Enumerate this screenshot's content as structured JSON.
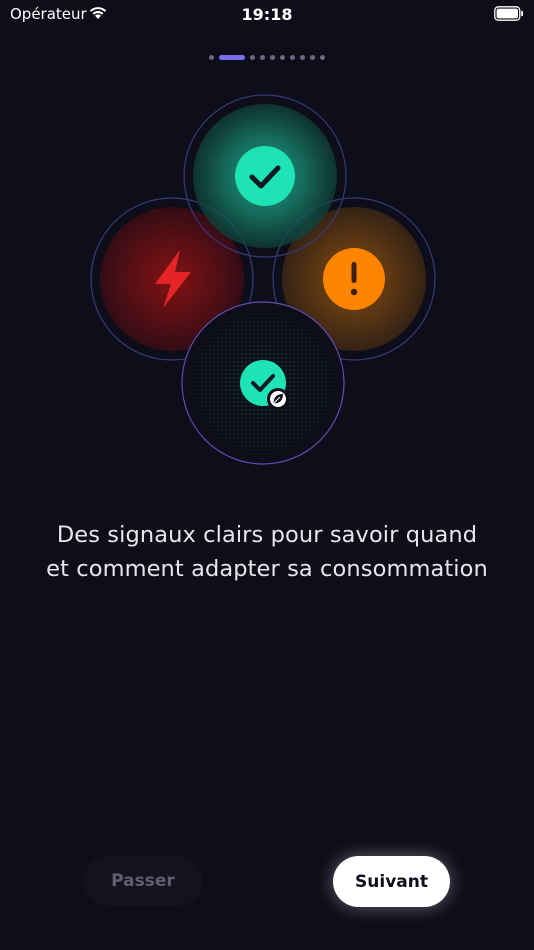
{
  "status_bar": {
    "carrier": "Opérateur",
    "time": "19:18"
  },
  "pager": {
    "total": 10,
    "active_index": 1
  },
  "onboarding": {
    "line1": "Des signaux clairs pour savoir quand",
    "line2": "et comment adapter sa consommation"
  },
  "signals": {
    "green": {
      "icon": "checkmark-icon",
      "color": "#1ee3b5"
    },
    "red": {
      "icon": "lightning-bolt-icon",
      "color": "#e02424"
    },
    "orange": {
      "icon": "exclamation-icon",
      "color": "#ff8a00"
    },
    "eco": {
      "icon": "checkmark-leaf-icon",
      "color": "#1ee3b5"
    }
  },
  "buttons": {
    "skip": "Passer",
    "next": "Suivant"
  }
}
